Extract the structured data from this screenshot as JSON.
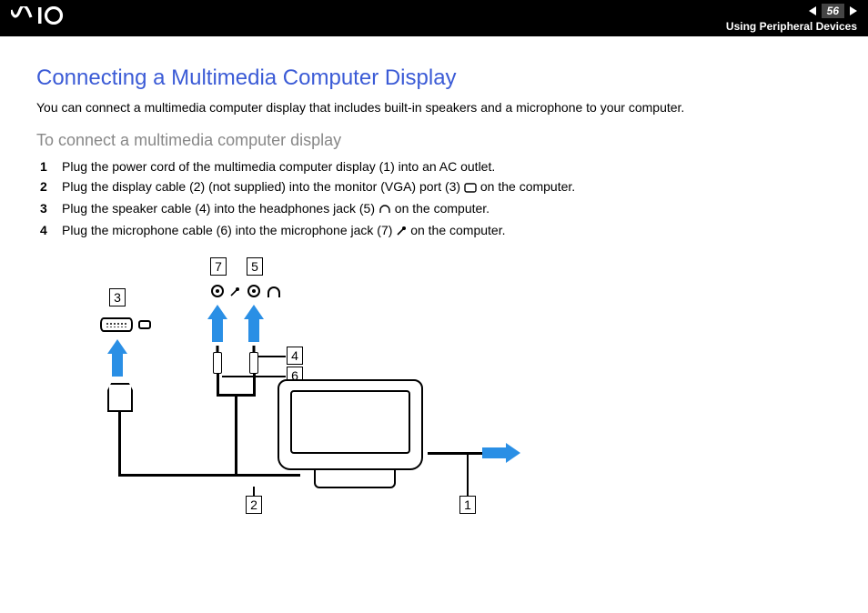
{
  "header": {
    "logo_text": "VAIO",
    "page_number": "56",
    "section": "Using Peripheral Devices"
  },
  "page": {
    "title": "Connecting a Multimedia Computer Display",
    "intro": "You can connect a multimedia computer display that includes built-in speakers and a microphone to your computer.",
    "subtitle": "To connect a multimedia computer display",
    "steps": [
      {
        "n": "1",
        "text_a": "Plug the power cord of the multimedia computer display (1) into an AC outlet.",
        "icon": ""
      },
      {
        "n": "2",
        "text_a": "Plug the display cable (2) (not supplied) into the monitor (VGA) port (3) ",
        "icon": "monitor",
        "text_b": " on the computer."
      },
      {
        "n": "3",
        "text_a": "Plug the speaker cable (4) into the headphones jack (5) ",
        "icon": "headphone",
        "text_b": " on the computer."
      },
      {
        "n": "4",
        "text_a": "Plug the microphone cable (6) into the microphone jack (7) ",
        "icon": "mic",
        "text_b": " on the computer."
      }
    ]
  },
  "diagram": {
    "callouts": {
      "c1": "1",
      "c2": "2",
      "c3": "3",
      "c4": "4",
      "c5": "5",
      "c6": "6",
      "c7": "7"
    }
  }
}
